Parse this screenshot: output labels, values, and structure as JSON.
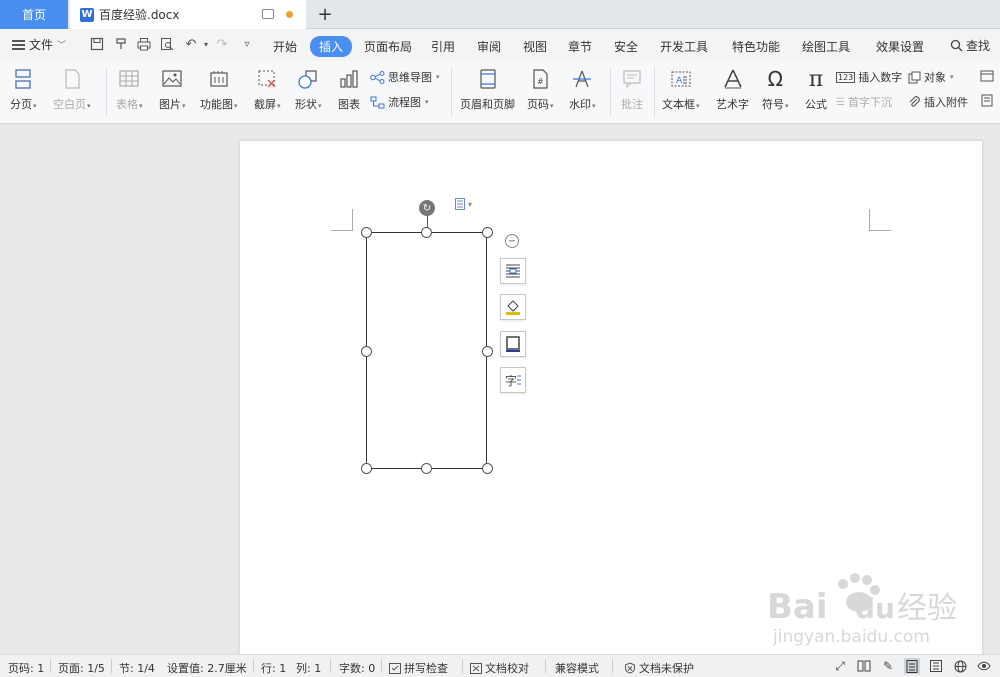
{
  "tabs": {
    "home": "首页",
    "doc_icon": "W",
    "doc_title": "百度经验.docx",
    "add": "+"
  },
  "menu": {
    "file_label": "文件",
    "tabs": [
      "开始",
      "插入",
      "页面布局",
      "引用",
      "审阅",
      "视图",
      "章节",
      "安全",
      "开发工具",
      "特色功能",
      "绘图工具",
      "效果设置"
    ],
    "active_tab": "插入",
    "search_label": "查找"
  },
  "ribbon": {
    "page_break": "分页",
    "blank_page": "空白页",
    "table": "表格",
    "picture": "图片",
    "function_chart": "功能图",
    "screenshot": "截屏",
    "shape": "形状",
    "chart": "图表",
    "mindmap": "思维导图",
    "flowchart": "流程图",
    "header_footer": "页眉和页脚",
    "page_number": "页码",
    "watermark": "水印",
    "comment": "批注",
    "textbox": "文本框",
    "wordart": "艺术字",
    "symbol": "符号",
    "formula": "公式",
    "insert_number": "插入数字",
    "object": "对象",
    "drop_cap": "首字下沉",
    "attachment": "插入附件"
  },
  "canvas": {
    "layout_icon_label": "▾"
  },
  "status": {
    "page_num": "页码: 1",
    "page_count": "页面: 1/5",
    "section": "节: 1/4",
    "setting": "设置值: 2.7厘米",
    "row": "行: 1",
    "col": "列: 1",
    "word_count": "字数: 0",
    "spell_check": "拼写检查",
    "doc_proof": "文档校对",
    "compat_mode": "兼容模式",
    "protect": "文档未保护"
  },
  "watermark": {
    "brand": "Bai",
    "brand2": "du",
    "brand_cn": "经验",
    "url": "jingyan.baidu.com"
  },
  "colors": {
    "accent": "#4a8ff0",
    "tab_bg": "#e3e6ea",
    "ribbon_bg": "#f7f8fa"
  }
}
